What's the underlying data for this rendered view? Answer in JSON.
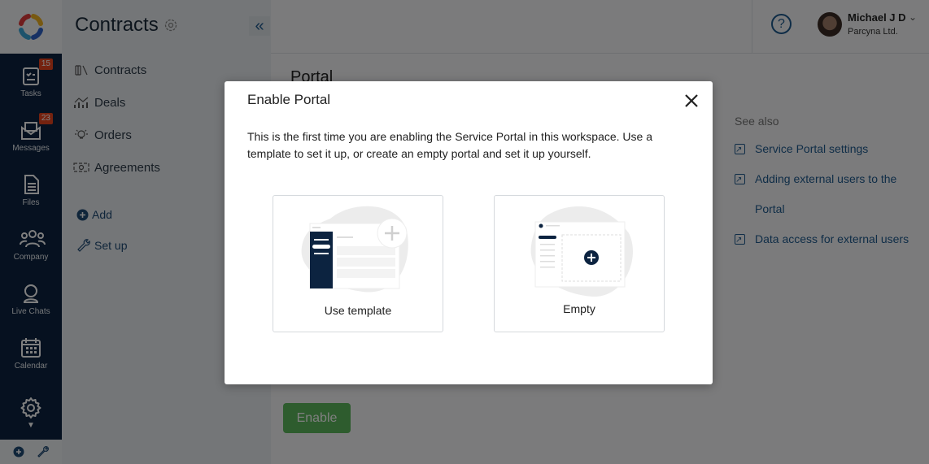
{
  "rail": {
    "items": [
      {
        "label": "Tasks",
        "icon": "tasks-icon",
        "badge": "15"
      },
      {
        "label": "Messages",
        "icon": "messages-icon",
        "badge": "23"
      },
      {
        "label": "Files",
        "icon": "files-icon",
        "badge": null
      },
      {
        "label": "Company",
        "icon": "company-icon",
        "badge": null
      },
      {
        "label": "Live Chats",
        "icon": "live-chats-icon",
        "badge": null
      },
      {
        "label": "Calendar",
        "icon": "calendar-icon",
        "badge": null
      }
    ]
  },
  "sidebar": {
    "title": "Contracts",
    "collapse_glyph": "«",
    "items": [
      {
        "label": "Contracts",
        "icon": "books-icon"
      },
      {
        "label": "Deals",
        "icon": "chart-icon"
      },
      {
        "label": "Orders",
        "icon": "lightbulb-icon"
      },
      {
        "label": "Agreements",
        "icon": "banknote-icon"
      }
    ],
    "add_label": "Add",
    "setup_label": "Set up"
  },
  "header": {
    "help_glyph": "?",
    "user_name": "Michael J D",
    "company": "Parcyna Ltd."
  },
  "main": {
    "title": "Portal",
    "see_also": {
      "title": "See also",
      "links": [
        "Service Portal settings",
        "Adding external users to the Portal",
        "Data access for external users"
      ]
    },
    "enable_label": "Enable",
    "enable_color": "#5cb85c"
  },
  "modal": {
    "title": "Enable Portal",
    "description": "This is the first time you are enabling the Service Portal in this workspace. Use a template to set it up, or create an empty portal and set it up yourself.",
    "options": [
      {
        "label": "Use template"
      },
      {
        "label": "Empty"
      }
    ]
  }
}
